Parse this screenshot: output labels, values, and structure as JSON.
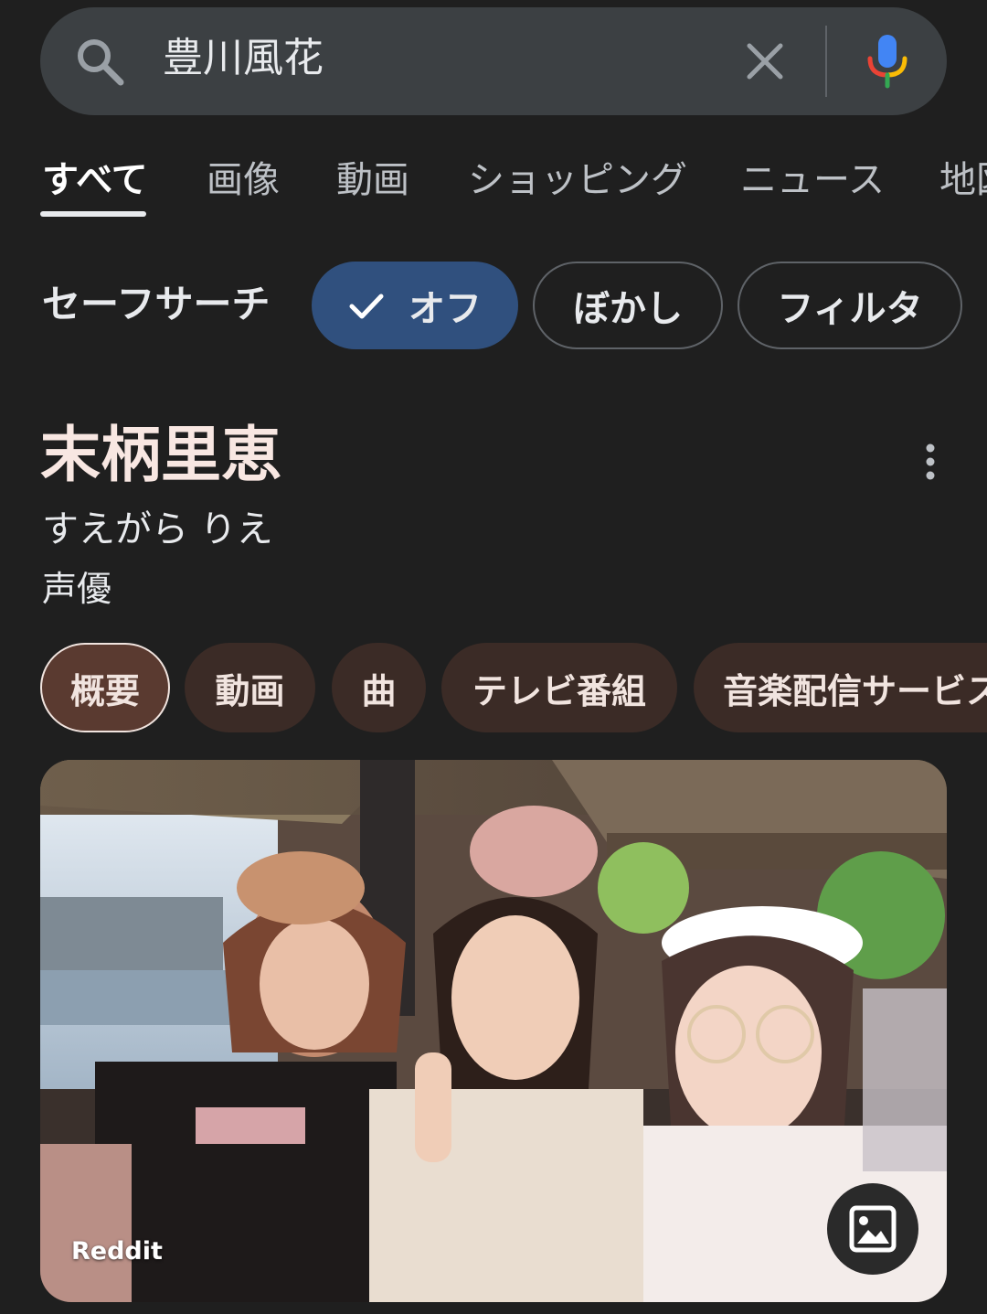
{
  "search": {
    "query": "豊川風花"
  },
  "tabs": [
    {
      "label": "すべて"
    },
    {
      "label": "画像"
    },
    {
      "label": "動画"
    },
    {
      "label": "ショッピング"
    },
    {
      "label": "ニュース"
    },
    {
      "label": "地図"
    }
  ],
  "safe_search": {
    "label": "セーフサーチ",
    "options": [
      {
        "label": "オフ",
        "selected": true
      },
      {
        "label": "ぼかし"
      },
      {
        "label": "フィルタ"
      }
    ]
  },
  "knowledge_panel": {
    "title": "末柄里恵",
    "reading": "すえがら りえ",
    "type": "声優",
    "chips": [
      {
        "label": "概要"
      },
      {
        "label": "動画"
      },
      {
        "label": "曲"
      },
      {
        "label": "テレビ番組"
      },
      {
        "label": "音楽配信サービス"
      }
    ],
    "image": {
      "source": "Reddit"
    }
  },
  "colors": {
    "background": "#1f1f1f",
    "search_bar": "#3c4043",
    "selected_chip": "#30507e",
    "topic_chip": "#3b2b26"
  }
}
